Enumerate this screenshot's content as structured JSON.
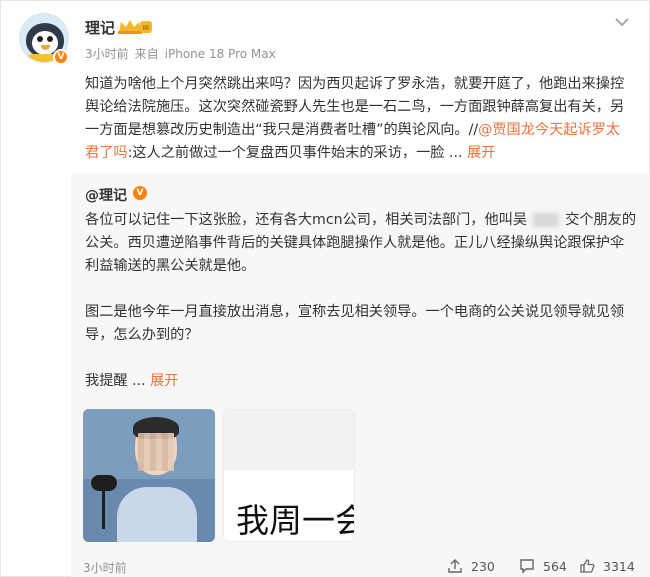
{
  "author": {
    "name": "理记",
    "level_badge": "III",
    "time": "3小时前",
    "source_prefix": "来自",
    "device": "iPhone 18 Pro Max",
    "verified_badge": "V"
  },
  "post": {
    "text_main": "知道为啥他上个月突然跳出来吗？因为西贝起诉了罗永浩，就要开庭了，他跑出来操控舆论给法院施压。这次突然碰瓷野人先生也是一石二鸟，一方面跟钟薛高复出有关，另一方面是想篡改历史制造出“我只是消费者吐槽”的舆论风向。//",
    "mention_link": "@贾国龙今天起诉罗太君了吗",
    "text_tail": ":这人之前做过一个复盘西贝事件始末的采访，一脸 ...",
    "expand_label": "展开"
  },
  "repost": {
    "author_prefix": "@",
    "author_name": "理记",
    "verified_badge": "V",
    "para1_a": "各位可以记住一下这张脸，还有各大mcn公司，相关司法部门，他叫吴",
    "para1_b": "交个朋友的公关。西贝遭逆陷事件背后的关键具体跑腿操作人就是他。正儿八经操纵舆论跟保护伞利益输送的黑公关就是他。",
    "para2": "图二是他今年一月直接放出消息，宣称去见相关领导。一个电商的公关说见领导就见领导，怎么办到的？",
    "para3_a": "我提醒 ...",
    "expand_label": "展开",
    "image2_text": "我周一会",
    "time": "3小时前",
    "reposts": "230",
    "comments": "564",
    "likes": "3314"
  },
  "icons": {
    "more": "chevron-down-icon",
    "repost": "share-icon",
    "comment": "comment-icon",
    "like": "thumbs-up-icon"
  },
  "colors": {
    "link": "#eb7340",
    "verified": "#ff8200",
    "meta": "#939393",
    "repost_bg": "#f7f7f7"
  }
}
